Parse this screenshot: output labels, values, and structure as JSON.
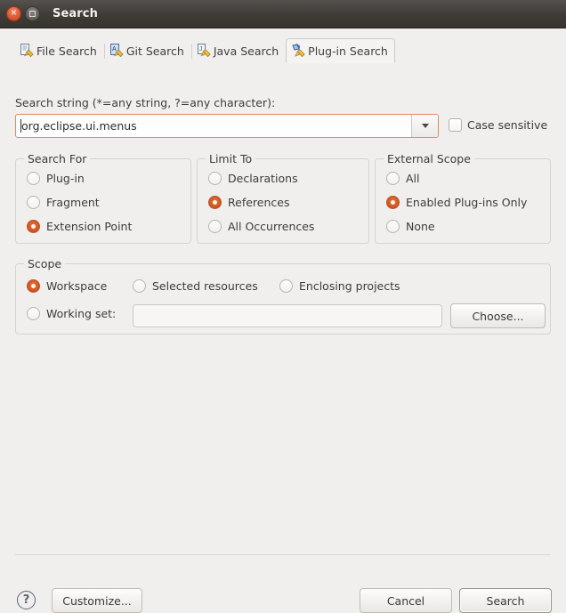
{
  "window": {
    "title": "Search",
    "close_icon": "close-icon",
    "maximize_icon": "maximize-icon"
  },
  "tabs": [
    {
      "label": "File Search",
      "icon": "file-search-icon",
      "active": false
    },
    {
      "label": "Git Search",
      "icon": "git-search-icon",
      "active": false
    },
    {
      "label": "Java Search",
      "icon": "java-search-icon",
      "active": false
    },
    {
      "label": "Plug-in Search",
      "icon": "plugin-search-icon",
      "active": true
    }
  ],
  "search": {
    "label": "Search string (*=any string, ?=any character):",
    "value": "org.eclipse.ui.menus",
    "placeholder": "",
    "dropdown_icon": "chevron-down-icon",
    "case_sensitive_label": "Case sensitive",
    "case_sensitive_checked": false
  },
  "search_for": {
    "title": "Search For",
    "options": [
      {
        "label": "Plug-in",
        "selected": false
      },
      {
        "label": "Fragment",
        "selected": false
      },
      {
        "label": "Extension Point",
        "selected": true
      }
    ]
  },
  "limit_to": {
    "title": "Limit To",
    "options": [
      {
        "label": "Declarations",
        "selected": false
      },
      {
        "label": "References",
        "selected": true
      },
      {
        "label": "All Occurrences",
        "selected": false
      }
    ]
  },
  "external_scope": {
    "title": "External Scope",
    "options": [
      {
        "label": "All",
        "selected": false
      },
      {
        "label": "Enabled Plug-ins Only",
        "selected": true
      },
      {
        "label": "None",
        "selected": false
      }
    ]
  },
  "scope": {
    "title": "Scope",
    "options": [
      {
        "label": "Workspace",
        "selected": true
      },
      {
        "label": "Selected resources",
        "selected": false
      },
      {
        "label": "Enclosing projects",
        "selected": false
      },
      {
        "label": "Working set:",
        "selected": false
      }
    ],
    "working_set_value": "",
    "choose_label": "Choose..."
  },
  "footer": {
    "help_icon": "help-icon",
    "help_glyph": "?",
    "customize_label": "Customize...",
    "cancel_label": "Cancel",
    "search_label": "Search"
  },
  "colors": {
    "accent": "#d2551f",
    "focus_border": "#e08a5f",
    "background": "#f0efee",
    "titlebar": "#3f3c39"
  }
}
